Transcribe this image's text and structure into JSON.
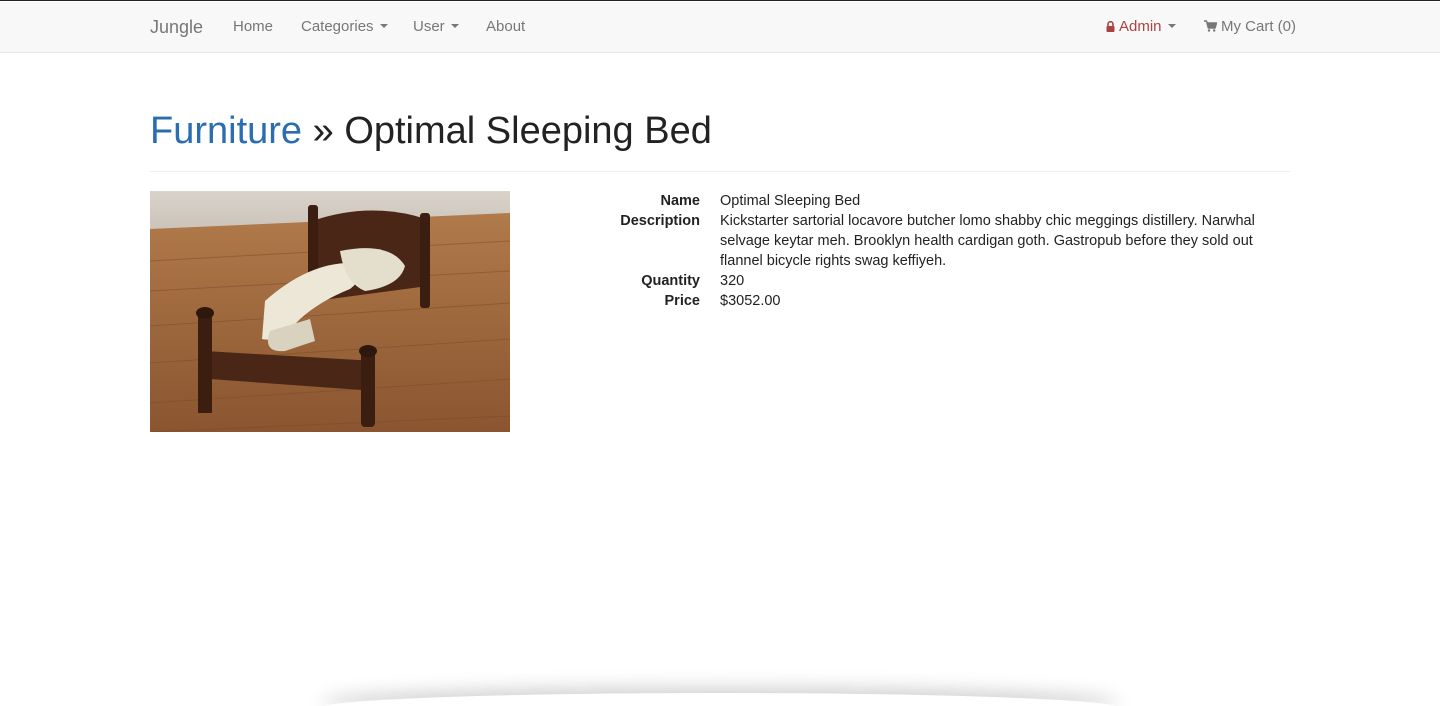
{
  "navbar": {
    "brand": "Jungle",
    "home": "Home",
    "categories": "Categories",
    "user": "User",
    "about": "About",
    "admin": "Admin",
    "cart": "My Cart (0)"
  },
  "header": {
    "category_link": "Furniture",
    "separator": " » ",
    "product_title": "Optimal Sleeping Bed"
  },
  "product": {
    "image_alt_subject": "bed-photo",
    "fields": {
      "name_label": "Name",
      "name_value": "Optimal Sleeping Bed",
      "description_label": "Description",
      "description_value": "Kickstarter sartorial locavore butcher lomo shabby chic meggings distillery. Narwhal selvage keytar meh. Brooklyn health cardigan goth. Gastropub before they sold out flannel bicycle rights swag keffiyeh.",
      "quantity_label": "Quantity",
      "quantity_value": "320",
      "price_label": "Price",
      "price_value": "$3052.00"
    }
  },
  "colors": {
    "link": "#2a6db0",
    "admin": "#a94442",
    "navbar_bg": "#f8f8f8"
  }
}
